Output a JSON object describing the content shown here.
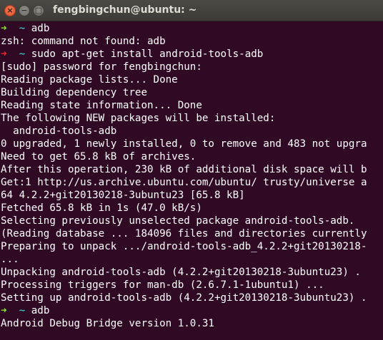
{
  "window": {
    "title": "fengbingchun@ubuntu: ~",
    "close_glyph": "×",
    "min_glyph": "−",
    "max_glyph": "□"
  },
  "colors": {
    "background": "#300a24",
    "text": "#ffffff",
    "prompt_ok": "#8ae234",
    "prompt_err": "#ef2929",
    "cwd": "#34e2e2"
  },
  "prompt": {
    "ok_arrow": "➜",
    "err_arrow": "➜",
    "cwd": "~"
  },
  "lines": [
    {
      "type": "prompt",
      "status": "ok",
      "command": "adb"
    },
    {
      "type": "output",
      "text": "zsh: command not found: adb"
    },
    {
      "type": "prompt",
      "status": "err",
      "command": "sudo apt-get install android-tools-adb"
    },
    {
      "type": "output",
      "text": "[sudo] password for fengbingchun:"
    },
    {
      "type": "output",
      "text": "Reading package lists... Done"
    },
    {
      "type": "output",
      "text": "Building dependency tree"
    },
    {
      "type": "output",
      "text": "Reading state information... Done"
    },
    {
      "type": "output",
      "text": "The following NEW packages will be installed:"
    },
    {
      "type": "output",
      "text": "  android-tools-adb"
    },
    {
      "type": "output",
      "text": "0 upgraded, 1 newly installed, 0 to remove and 483 not upgra"
    },
    {
      "type": "output",
      "text": "Need to get 65.8 kB of archives."
    },
    {
      "type": "output",
      "text": "After this operation, 230 kB of additional disk space will b"
    },
    {
      "type": "output",
      "text": "Get:1 http://us.archive.ubuntu.com/ubuntu/ trusty/universe a"
    },
    {
      "type": "output",
      "text": "64 4.2.2+git20130218-3ubuntu23 [65.8 kB]"
    },
    {
      "type": "output",
      "text": "Fetched 65.8 kB in 1s (47.0 kB/s)"
    },
    {
      "type": "output",
      "text": "Selecting previously unselected package android-tools-adb."
    },
    {
      "type": "output",
      "text": "(Reading database ... 184096 files and directories currently"
    },
    {
      "type": "output",
      "text": "Preparing to unpack .../android-tools-adb_4.2.2+git20130218-"
    },
    {
      "type": "output",
      "text": "..."
    },
    {
      "type": "output",
      "text": "Unpacking android-tools-adb (4.2.2+git20130218-3ubuntu23) ."
    },
    {
      "type": "output",
      "text": "Processing triggers for man-db (2.6.7.1-1ubuntu1) ..."
    },
    {
      "type": "output",
      "text": "Setting up android-tools-adb (4.2.2+git20130218-3ubuntu23) ."
    },
    {
      "type": "prompt",
      "status": "ok",
      "command": "adb"
    },
    {
      "type": "output",
      "text": "Android Debug Bridge version 1.0.31"
    }
  ]
}
